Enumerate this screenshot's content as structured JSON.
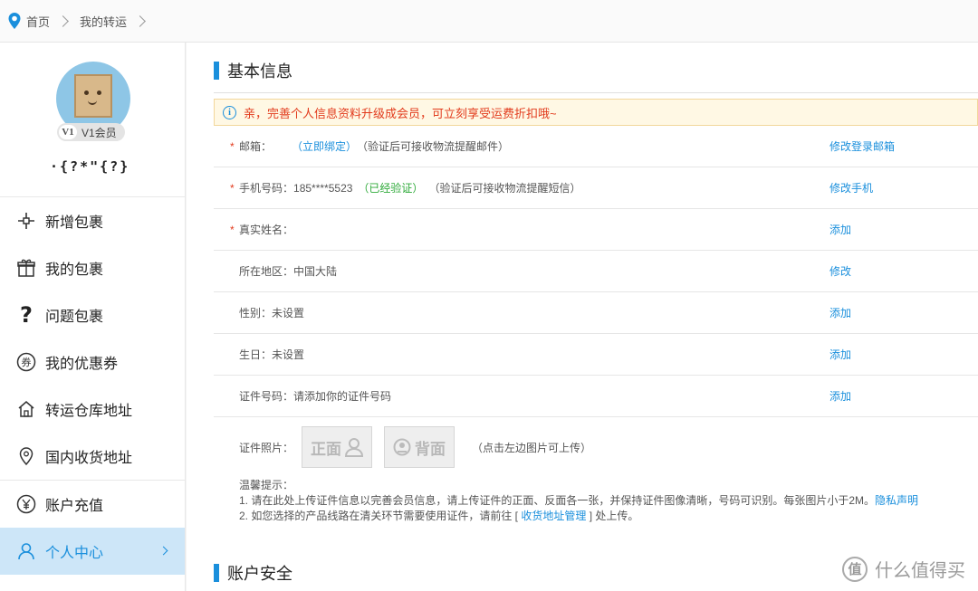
{
  "breadcrumb": {
    "home": "首页",
    "current": "我的转运"
  },
  "profile": {
    "level_icon": "V1",
    "level": "V1会员",
    "username": "·{?*\"{?}"
  },
  "nav": [
    {
      "label": "新增包裹",
      "icon": "plus-icon"
    },
    {
      "label": "我的包裹",
      "icon": "gift-box-icon"
    },
    {
      "label": "问题包裹",
      "icon": "question-icon"
    },
    {
      "label": "我的优惠券",
      "icon": "coupon-icon"
    },
    {
      "label": "转运仓库地址",
      "icon": "house-icon"
    },
    {
      "label": "国内收货地址",
      "icon": "location-pin-icon"
    },
    {
      "label": "账户充值",
      "icon": "yen-icon"
    },
    {
      "label": "个人中心",
      "icon": "user-icon",
      "active": true
    }
  ],
  "basic_info": {
    "title": "基本信息",
    "notice": "亲，完善个人信息资料升级成会员，可立刻享受运费折扣哦~",
    "rows": {
      "email": {
        "label": "邮箱：",
        "link": "（立即绑定）",
        "hint": "（验证后可接收物流提醒邮件）",
        "action": "修改登录邮箱"
      },
      "phone": {
        "label": "手机号码：",
        "value": "185****5523",
        "status": "（已经验证）",
        "hint": "（验证后可接收物流提醒短信）",
        "action": "修改手机"
      },
      "name": {
        "label": "真实姓名：",
        "action": "添加"
      },
      "region": {
        "label": "所在地区：",
        "value": "中国大陆",
        "action": "修改"
      },
      "gender": {
        "label": "性别：",
        "value": "未设置",
        "action": "添加"
      },
      "birthday": {
        "label": "生日：",
        "value": "未设置",
        "action": "添加"
      },
      "id_number": {
        "label": "证件号码：",
        "value": "请添加你的证件号码",
        "action": "添加"
      }
    },
    "id_photo": {
      "label": "证件照片：",
      "front": "正面",
      "back": "背面",
      "hint": "（点击左边图片可上传）"
    },
    "tips": {
      "title": "温馨提示：",
      "line1": "1. 请在此处上传证件信息以完善会员信息，请上传证件的正面、反面各一张，并保持证件图像清晰，号码可识别。每张图片小于2M。",
      "line1_link": "隐私声明",
      "line2_pre": "2. 如您选择的产品线路在清关环节需要使用证件，请前往 [",
      "line2_link": "收货地址管理",
      "line2_post": "] 处上传。"
    }
  },
  "account_security": {
    "title": "账户安全"
  },
  "watermark": {
    "symbol": "值",
    "text": "什么值得买"
  },
  "colors": {
    "accent": "#1a8fdc",
    "warning": "#e23b1d",
    "success": "#2faa3a",
    "active_bg": "#cde6f8"
  }
}
